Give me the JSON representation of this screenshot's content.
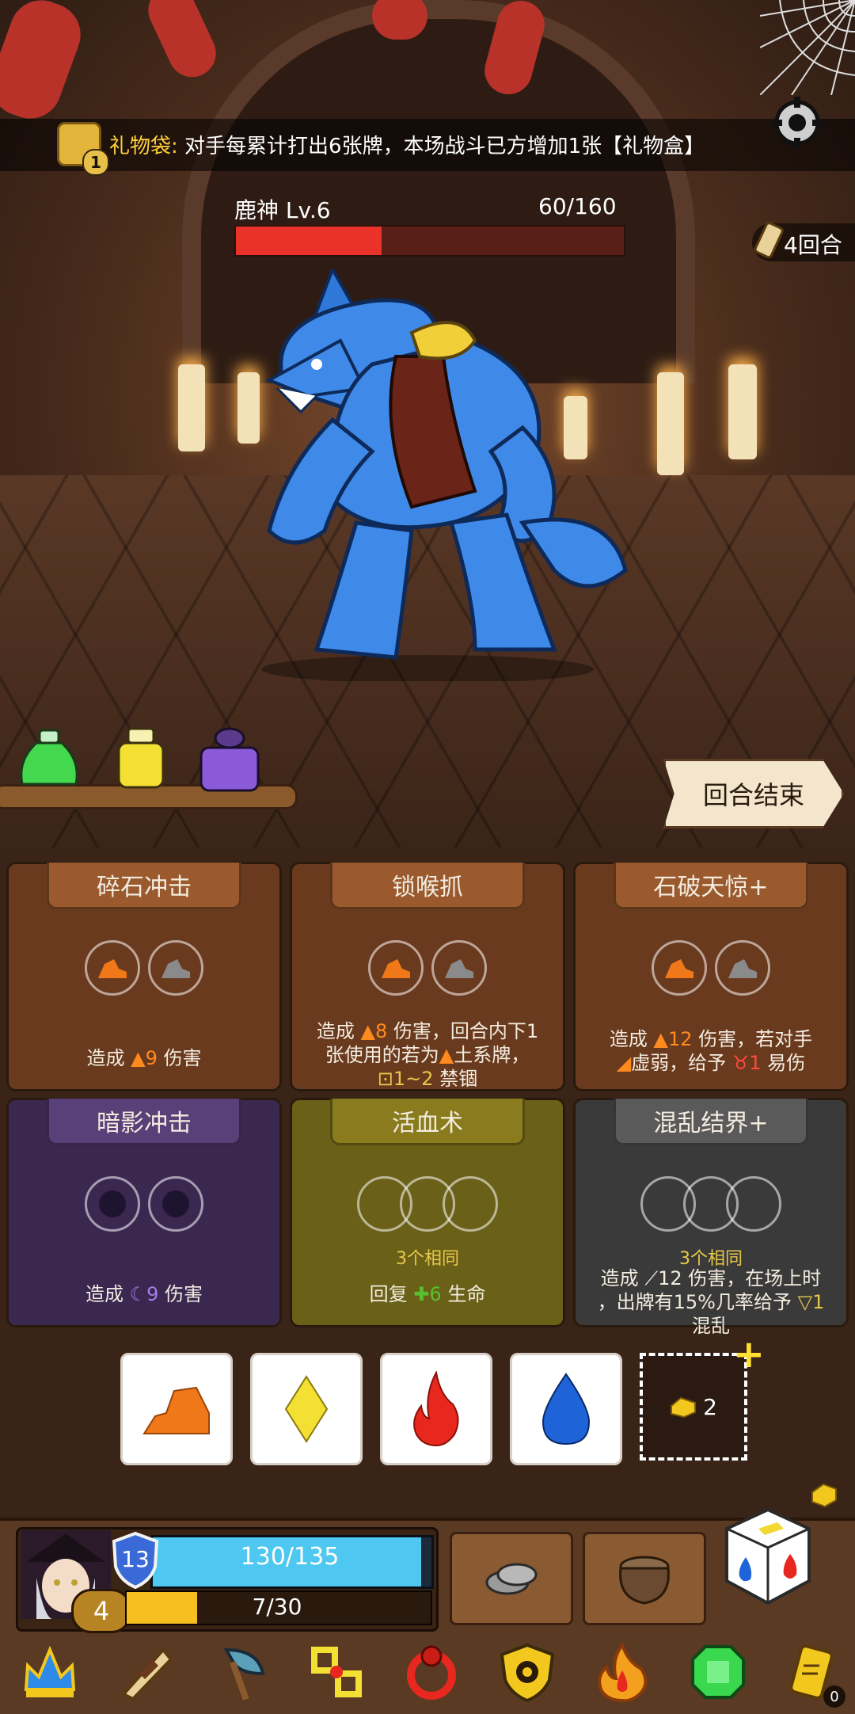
{
  "banner": {
    "title": "礼物袋",
    "colon": ":",
    "text": " 对手每累计打出6张牌，本场战斗已方增加1张【礼物盒】",
    "count": "1"
  },
  "enemy": {
    "name": "鹿神  Lv.6",
    "hp_text": "60/160",
    "hp_fraction": 0.375
  },
  "round": {
    "label": "4回合"
  },
  "potions": [
    "green-potion-icon",
    "yellow-potion-icon",
    "purple-potion-icon"
  ],
  "end_turn": {
    "label": "回合结束"
  },
  "cards": [
    {
      "title": "碎石冲击",
      "theme": "earth",
      "desc_pre": "造成 ",
      "value": "9",
      "desc_post": " 伤害"
    },
    {
      "title": "锁喉抓",
      "theme": "earth",
      "line1_pre": "造成 ",
      "value": "8",
      "line1_post": " 伤害，回合内下1",
      "line2": "张使用的若为",
      "line2_post": "土系牌，",
      "lock_value": "1~2",
      "lock_label": " 禁锢"
    },
    {
      "title": "石破天惊+",
      "theme": "earth",
      "line1_pre": "造成 ",
      "value": "12",
      "line1_post": " 伤害，若对手",
      "line2": "虚弱，给予 ",
      "value2": "1",
      "line2_post": " 易伤"
    },
    {
      "title": "暗影冲击",
      "theme": "dark",
      "desc_pre": "造成 ",
      "value": "9",
      "desc_post": " 伤害"
    },
    {
      "title": "活血术",
      "theme": "olive",
      "same": "3个相同",
      "desc_pre": "回复 ",
      "value": "6",
      "desc_post": " 生命"
    },
    {
      "title": "混乱结界+",
      "theme": "grey",
      "same": "3个相同",
      "line1_pre": "造成 ",
      "value": "12",
      "line1_post": " 伤害，在场上时",
      "line2": "，出牌有15%几率给予 ",
      "value2": "1",
      "line3": "混乱"
    }
  ],
  "dice": [
    {
      "icon": "earth-die-icon",
      "color": "#f07818"
    },
    {
      "icon": "lightning-die-icon",
      "color": "#f3e032"
    },
    {
      "icon": "fire-die-icon",
      "color": "#e8281e"
    },
    {
      "icon": "water-die-icon",
      "color": "#1e64d8"
    }
  ],
  "add_die": {
    "count": "2",
    "plus": "+"
  },
  "player": {
    "level": "4",
    "shield": "13",
    "hp_text": "130/135",
    "hp_fraction": 0.963,
    "xp_text": "7/30",
    "xp_fraction": 0.233
  },
  "items": [
    "crown-icon",
    "horn-icon",
    "axe-icon",
    "chain-icon",
    "ring-icon",
    "shield-icon",
    "flame-icon",
    "emerald-icon",
    "scroll-icon"
  ],
  "items_badge": "0",
  "colors": {
    "hp_red": "#e8322a",
    "hp_blue": "#4ec8f0",
    "xp_yellow": "#f6be1e",
    "accent_gold": "#ffcf3a"
  }
}
